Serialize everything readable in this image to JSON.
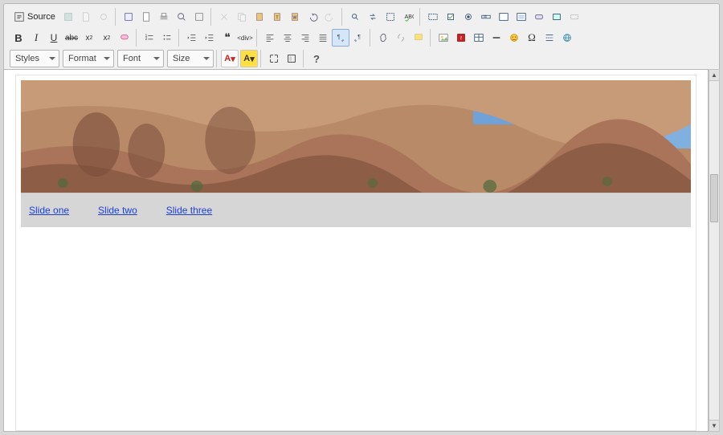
{
  "toolbar": {
    "source_label": "Source",
    "combos": {
      "styles": "Styles",
      "format": "Format",
      "font": "Font",
      "size": "Size"
    }
  },
  "row1_icons": [
    "source-icon",
    "newpage-icon",
    "preview-icon",
    "print-icon",
    "spacer",
    "templates-icon",
    "cut-icon",
    "copy-icon",
    "paste-icon",
    "paste-text-icon",
    "paste-word-icon",
    "undo-icon",
    "redo-icon",
    "spacer",
    "find-icon",
    "replace-icon",
    "selectall-icon",
    "spellcheck-icon",
    "spacer",
    "form-icon",
    "checkbox-icon",
    "radio-icon",
    "textfield-icon",
    "textarea-icon",
    "select-icon",
    "button-icon",
    "imagebutton-icon",
    "hidden-icon"
  ],
  "row2_icons": [
    "bold-icon",
    "italic-icon",
    "underline-icon",
    "strike-icon",
    "subscript-icon",
    "superscript-icon",
    "removeformat-icon",
    "spacer",
    "numberlist-icon",
    "bulletlist-icon",
    "spacer",
    "outdent-icon",
    "indent-icon",
    "blockquote-icon",
    "creatediv-icon",
    "spacer",
    "align-left-icon",
    "align-center-icon",
    "align-right-icon",
    "align-justify-icon",
    "ltr-icon",
    "rtl-icon",
    "spacer",
    "link-icon",
    "unlink-icon",
    "anchor-icon",
    "spacer",
    "image-icon",
    "flash-icon",
    "table-icon",
    "hr-icon",
    "smiley-icon",
    "specialchar-icon",
    "pagebreak-icon",
    "iframe-icon"
  ],
  "row3_extra": [
    "maximize-icon",
    "showblocks-icon",
    "about-icon"
  ],
  "textcolor": {
    "fg_label": "A",
    "bg_label": "A"
  },
  "content": {
    "slides": [
      "Slide one",
      "Slide two",
      "Slide three"
    ]
  }
}
